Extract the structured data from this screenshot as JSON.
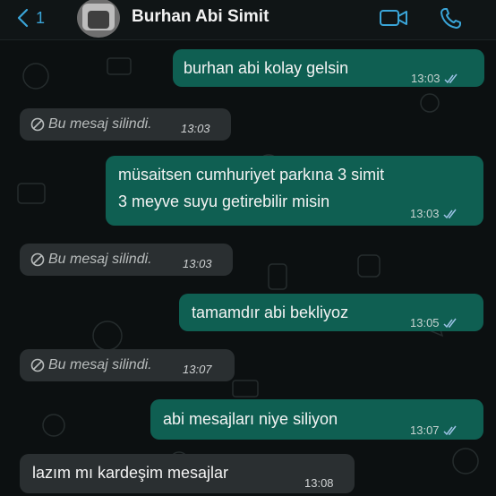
{
  "header": {
    "back_count": "1",
    "contact_name": "Burhan Abi Simit",
    "icons": {
      "back": "chevron-left-icon",
      "video": "video-camera-icon",
      "call": "phone-icon"
    },
    "accent": "#3aa5d8"
  },
  "messages": [
    {
      "side": "out",
      "text": "burhan abi kolay gelsin",
      "time": "13:03"
    },
    {
      "side": "in",
      "deleted": true,
      "text": "Bu mesaj silindi.",
      "time": "13:03"
    },
    {
      "side": "out",
      "text_lines": [
        "müsaitsen cumhuriyet parkına 3 simit",
        "3 meyve suyu getirebilir misin"
      ],
      "time": "13:03"
    },
    {
      "side": "in",
      "deleted": true,
      "text": "Bu mesaj silindi.",
      "time": "13:03"
    },
    {
      "side": "out",
      "text": "tamamdır abi bekliyoz",
      "time": "13:05"
    },
    {
      "side": "in",
      "deleted": true,
      "text": "Bu mesaj silindi.",
      "time": "13:07"
    },
    {
      "side": "out",
      "text": "abi mesajları niye siliyon",
      "time": "13:07"
    },
    {
      "side": "in",
      "text": "lazım mı kardeşim mesajlar",
      "time": "13:08"
    }
  ],
  "colors": {
    "outgoing_bubble": "#0f5f52",
    "incoming_bubble": "#2a2f31",
    "background": "#0c1011"
  }
}
